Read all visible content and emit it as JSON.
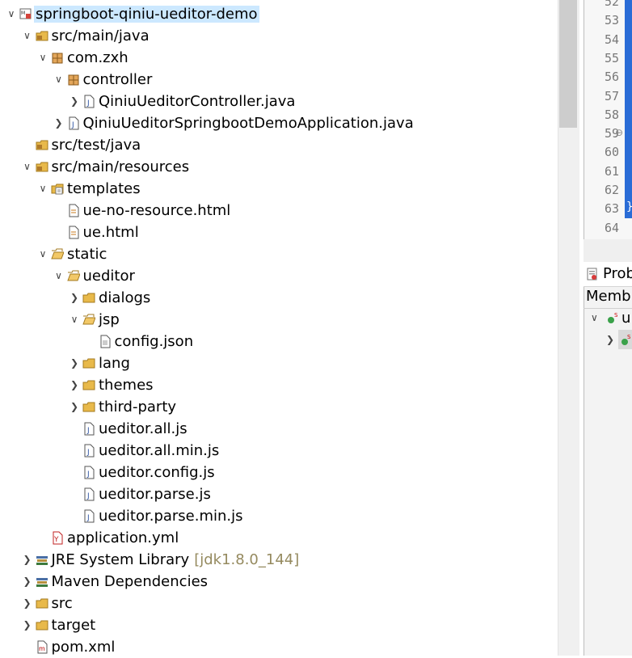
{
  "explorer": {
    "items": [
      {
        "label": "springboot-qiniu-ueditor-demo",
        "depth": 0,
        "chevron": "expanded",
        "icon": "maven-project-icon",
        "selected": true
      },
      {
        "label": "src/main/java",
        "depth": 1,
        "chevron": "expanded",
        "icon": "source-folder-icon"
      },
      {
        "label": "com.zxh",
        "depth": 2,
        "chevron": "expanded",
        "icon": "package-icon"
      },
      {
        "label": "controller",
        "depth": 3,
        "chevron": "expanded",
        "icon": "package-icon"
      },
      {
        "label": "QiniuUeditorController.java",
        "depth": 4,
        "chevron": "collapsed",
        "icon": "java-file-icon"
      },
      {
        "label": "QiniuUeditorSpringbootDemoApplication.java",
        "depth": 3,
        "chevron": "collapsed",
        "icon": "java-file-icon"
      },
      {
        "label": "src/test/java",
        "depth": 1,
        "chevron": "none",
        "icon": "source-folder-icon"
      },
      {
        "label": "src/main/resources",
        "depth": 1,
        "chevron": "expanded",
        "icon": "source-folder-icon"
      },
      {
        "label": "templates",
        "depth": 2,
        "chevron": "expanded",
        "icon": "templates-folder-icon"
      },
      {
        "label": "ue-no-resource.html",
        "depth": 3,
        "chevron": "none",
        "icon": "html-file-icon"
      },
      {
        "label": "ue.html",
        "depth": 3,
        "chevron": "none",
        "icon": "html-file-icon"
      },
      {
        "label": "static",
        "depth": 2,
        "chevron": "expanded",
        "icon": "open-folder-icon"
      },
      {
        "label": "ueditor",
        "depth": 3,
        "chevron": "expanded",
        "icon": "open-folder-icon"
      },
      {
        "label": "dialogs",
        "depth": 4,
        "chevron": "collapsed",
        "icon": "folder-icon"
      },
      {
        "label": "jsp",
        "depth": 4,
        "chevron": "expanded",
        "icon": "open-folder-icon"
      },
      {
        "label": "config.json",
        "depth": 5,
        "chevron": "none",
        "icon": "text-file-icon"
      },
      {
        "label": "lang",
        "depth": 4,
        "chevron": "collapsed",
        "icon": "folder-icon"
      },
      {
        "label": "themes",
        "depth": 4,
        "chevron": "collapsed",
        "icon": "folder-icon"
      },
      {
        "label": "third-party",
        "depth": 4,
        "chevron": "collapsed",
        "icon": "folder-icon"
      },
      {
        "label": "ueditor.all.js",
        "depth": 4,
        "chevron": "none",
        "icon": "js-file-icon"
      },
      {
        "label": "ueditor.all.min.js",
        "depth": 4,
        "chevron": "none",
        "icon": "js-file-icon"
      },
      {
        "label": "ueditor.config.js",
        "depth": 4,
        "chevron": "none",
        "icon": "js-file-icon"
      },
      {
        "label": "ueditor.parse.js",
        "depth": 4,
        "chevron": "none",
        "icon": "js-file-icon"
      },
      {
        "label": "ueditor.parse.min.js",
        "depth": 4,
        "chevron": "none",
        "icon": "js-file-icon"
      },
      {
        "label": "application.yml",
        "depth": 2,
        "chevron": "none",
        "icon": "yaml-file-icon"
      },
      {
        "label": "JRE System Library",
        "decoration": "[jdk1.8.0_144]",
        "depth": 1,
        "chevron": "collapsed",
        "icon": "library-icon"
      },
      {
        "label": "Maven Dependencies",
        "depth": 1,
        "chevron": "collapsed",
        "icon": "library-icon"
      },
      {
        "label": "src",
        "depth": 1,
        "chevron": "collapsed",
        "icon": "folder-icon"
      },
      {
        "label": "target",
        "depth": 1,
        "chevron": "collapsed",
        "icon": "folder-icon"
      },
      {
        "label": "pom.xml",
        "depth": 1,
        "chevron": "none",
        "icon": "maven-pom-icon"
      }
    ]
  },
  "editor": {
    "line_numbers": [
      "52",
      "53",
      "54",
      "55",
      "56",
      "57",
      "58",
      "59",
      "60",
      "61",
      "62",
      "63",
      "64"
    ],
    "fold_marker": "⊖",
    "brace": "}"
  },
  "problems_view": {
    "tab_label": "Prob",
    "tab_icon": "problems-icon",
    "subheader": "Memb",
    "outline_item_1": "u"
  },
  "colors": {
    "selection": "#cce8ff",
    "decoration": "#958a5f",
    "folder": "#e8b94a",
    "package": "#b07a2a",
    "editor_accent": "#2a6cd6"
  }
}
